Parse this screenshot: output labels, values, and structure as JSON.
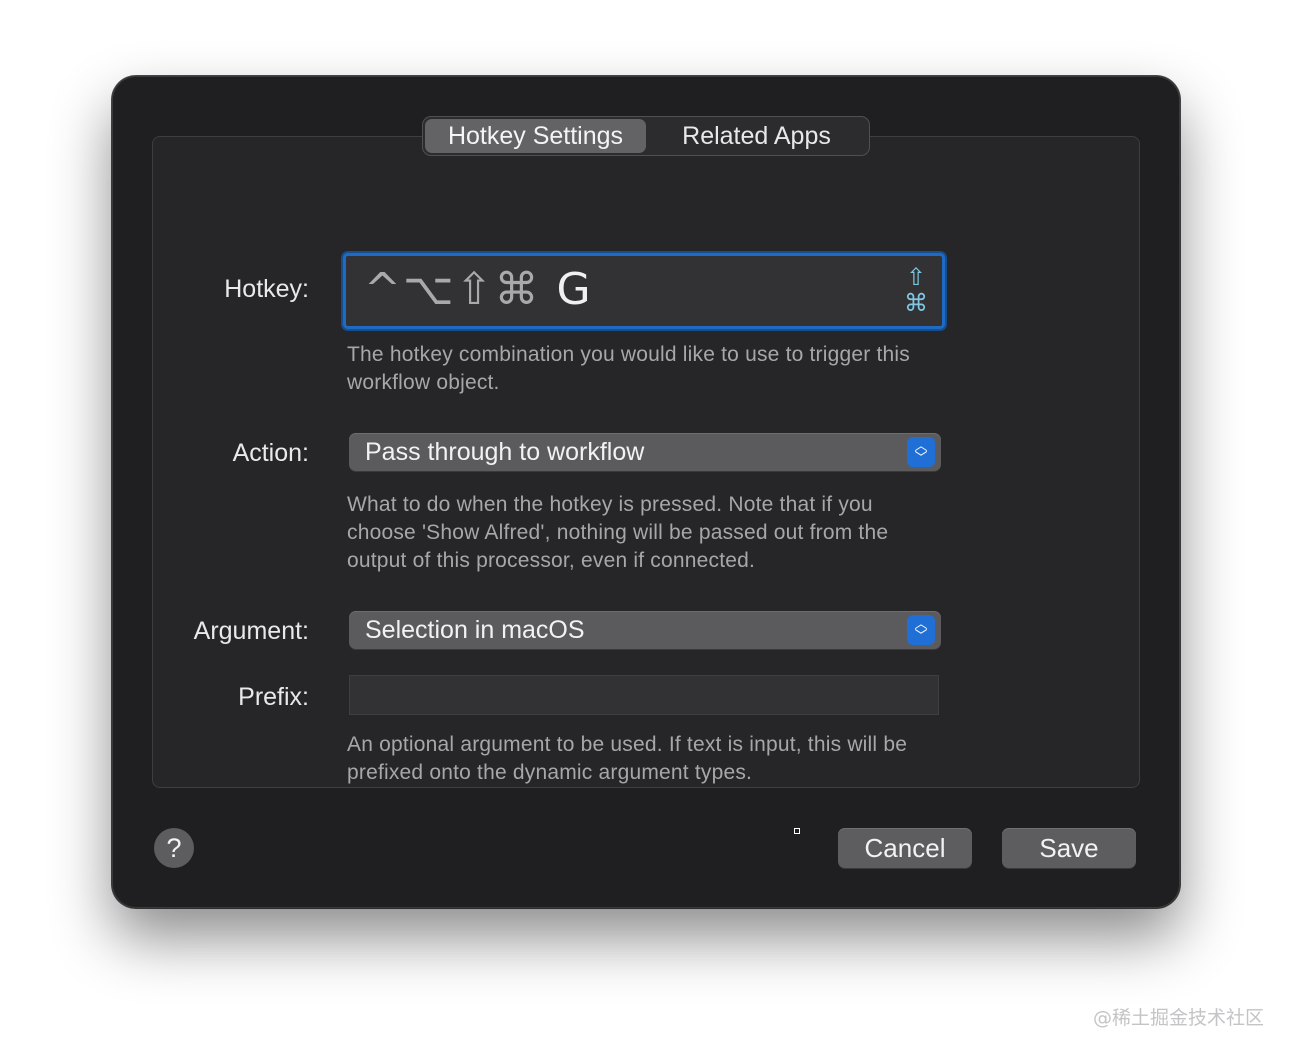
{
  "tabs": [
    {
      "label": "Hotkey Settings",
      "active": true
    },
    {
      "label": "Related Apps",
      "active": false
    }
  ],
  "hotkey": {
    "label": "Hotkey:",
    "modifiers": "^⌥⇧⌘",
    "key": "G",
    "side_icon_top": "⇧",
    "side_icon_bottom": "⌘",
    "help": "The hotkey combination you would like to use to trigger this workflow object."
  },
  "action": {
    "label": "Action:",
    "value": "Pass through to workflow",
    "help": "What to do when the hotkey is pressed. Note that if you choose 'Show Alfred', nothing will be passed out from the output of this processor, even if connected."
  },
  "argument": {
    "label": "Argument:",
    "value": "Selection in macOS"
  },
  "prefix": {
    "label": "Prefix:",
    "value": "",
    "help": "An optional argument to be used. If text is input, this will be prefixed onto the dynamic argument types."
  },
  "footer": {
    "help_label": "?",
    "cancel_label": "Cancel",
    "save_label": "Save"
  },
  "watermark": "@稀土掘金技术社区",
  "colors": {
    "accent": "#1f6fd6",
    "window_bg": "#1f1f21"
  }
}
